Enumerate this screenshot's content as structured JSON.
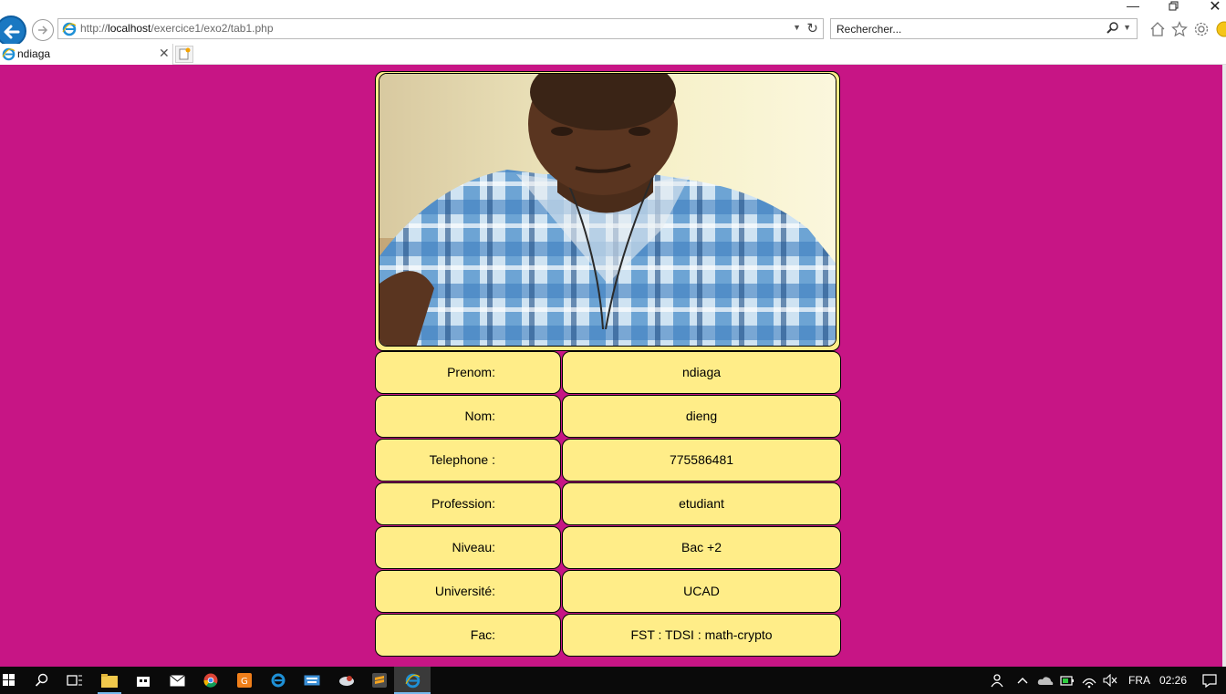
{
  "browser": {
    "url_prefix": "http://",
    "url_host": "localhost",
    "url_path": "/exercice1/exo2/tab1.php",
    "search_placeholder": "Rechercher...",
    "tab_title": "ndiaga"
  },
  "profile": {
    "photo_alt": "",
    "rows": [
      {
        "label": "Prenom:",
        "value": "ndiaga"
      },
      {
        "label": "Nom:",
        "value": "dieng"
      },
      {
        "label": "Telephone :",
        "value": "775586481"
      },
      {
        "label": "Profession:",
        "value": "etudiant"
      },
      {
        "label": "Niveau:",
        "value": "Bac +2"
      },
      {
        "label": "Université:",
        "value": "UCAD"
      },
      {
        "label": "Fac:",
        "value": "FST : TDSI : math-crypto"
      }
    ]
  },
  "taskbar": {
    "language": "FRA",
    "time": "02:26"
  },
  "colors": {
    "page_bg": "#c71585",
    "cell_bg": "#ffed88",
    "taskbar_bg": "#0a0a0a"
  }
}
